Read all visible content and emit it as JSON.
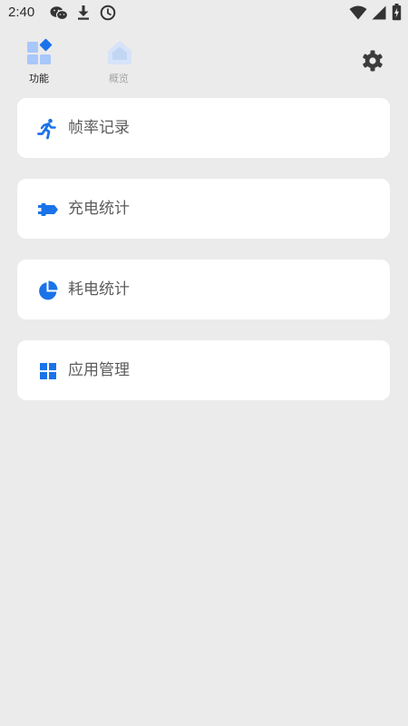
{
  "status_bar": {
    "time": "2:40",
    "icons": [
      "wechat-icon",
      "download-icon",
      "clock-icon",
      "wifi-icon",
      "signal-icon",
      "battery-icon"
    ]
  },
  "tabs": [
    {
      "label": "功能",
      "icon": "features-grid-icon",
      "active": true
    },
    {
      "label": "概览",
      "icon": "home-icon",
      "active": false
    }
  ],
  "settings": {
    "icon": "gear-icon"
  },
  "menu": [
    {
      "label": "帧率记录",
      "icon": "running-icon"
    },
    {
      "label": "充电统计",
      "icon": "charging-plug-icon"
    },
    {
      "label": "耗电统计",
      "icon": "pie-chart-icon"
    },
    {
      "label": "应用管理",
      "icon": "grid-apps-icon"
    }
  ],
  "colors": {
    "accent": "#1a73e8",
    "accent_light": "#a8c7fa",
    "background": "#ebebeb",
    "card": "#ffffff"
  }
}
